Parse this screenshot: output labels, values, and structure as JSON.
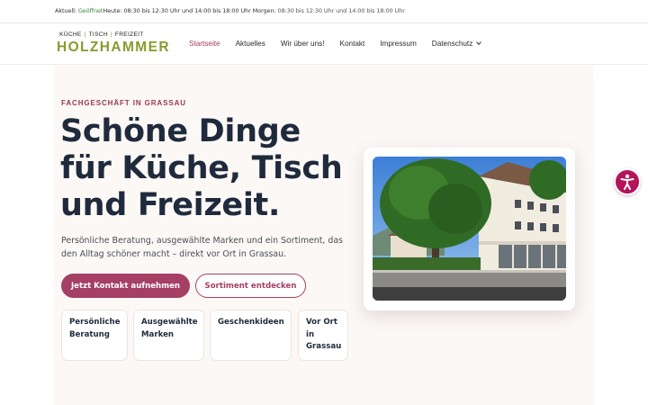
{
  "topbar": {
    "label": "Aktuell:",
    "status": "Geöffnet",
    "today": "Heute: 08:30 bis 12:30 Uhr und 14:00 bis 18:00 Uhr",
    "tomorrow_label": "Morgen:",
    "tomorrow": "08:30 bis 12:30 Uhr und 14:00 bis 18:00 Uhr",
    "status_color": "#2f8f3a"
  },
  "logo": {
    "tag_1": "KÜCHE",
    "tag_2": "TISCH",
    "tag_3": "FREIZEIT",
    "sep": "|",
    "name": "HOLZHAMMER",
    "color": "#8a9a2e"
  },
  "nav": {
    "items": [
      {
        "label": "Startseite",
        "active": true
      },
      {
        "label": "Aktuelles",
        "active": false
      },
      {
        "label": "Wir über uns!",
        "active": false
      },
      {
        "label": "Kontakt",
        "active": false
      },
      {
        "label": "Impressum",
        "active": false
      },
      {
        "label": "Datenschutz",
        "active": false,
        "icon": "chevron-down-icon"
      }
    ],
    "active_color": "#a3385e"
  },
  "hero": {
    "eyebrow": "FACHGESCHÄFT IN GRASSAU",
    "headline_1": "Schöne Dinge",
    "headline_2": "für Küche, Tisch",
    "headline_3": "und Freizeit.",
    "lead": "Persönliche Beratung, ausgewählte Marken und ein Sortiment, das den Alltag schöner macht – direkt vor Ort in Grassau.",
    "primary_cta": "Jetzt Kontakt aufnehmen",
    "secondary_cta": "Sortiment entdecken",
    "accent_color": "#a53f64",
    "features": [
      "Persönliche Beratung",
      "Ausgewählte Marken",
      "Geschenkideen",
      "Vor Ort in Grassau"
    ]
  },
  "icons": {
    "accessibility": "accessibility-icon",
    "accessibility_color": "#b3145a"
  }
}
